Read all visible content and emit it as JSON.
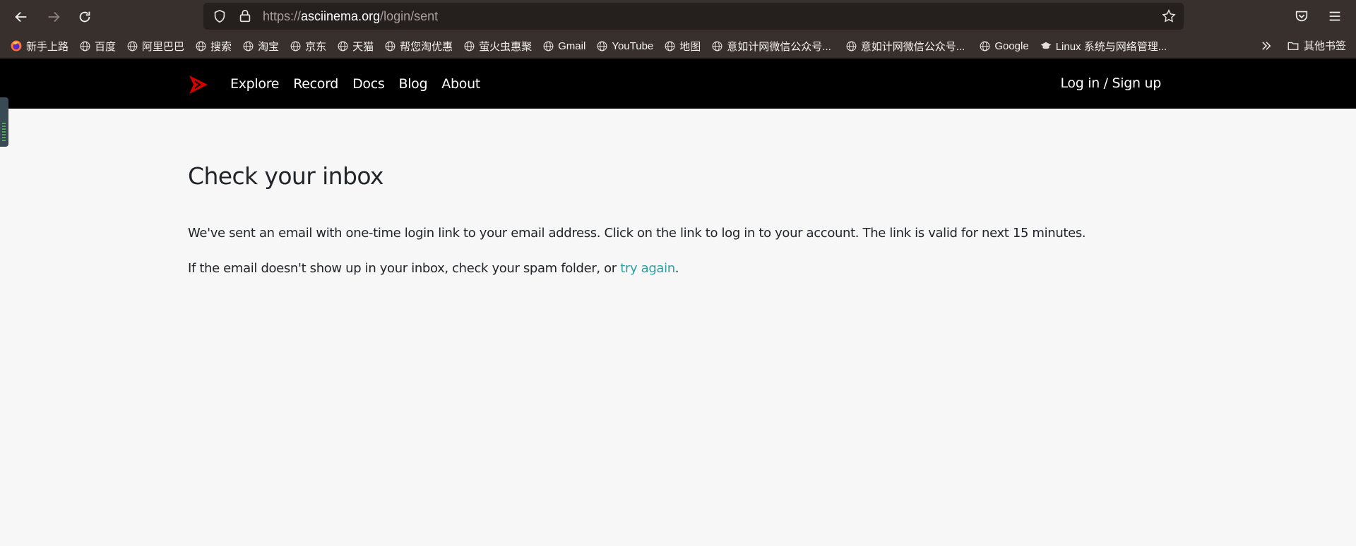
{
  "browser": {
    "url": {
      "scheme": "https://",
      "host": "asciinema.org",
      "path": "/login/sent"
    },
    "bookmarks": [
      {
        "label": "新手上路",
        "icon": "firefox-icon"
      },
      {
        "label": "百度",
        "icon": "globe-icon"
      },
      {
        "label": "阿里巴巴",
        "icon": "globe-icon"
      },
      {
        "label": "搜索",
        "icon": "globe-icon"
      },
      {
        "label": "淘宝",
        "icon": "globe-icon"
      },
      {
        "label": "京东",
        "icon": "globe-icon"
      },
      {
        "label": "天猫",
        "icon": "globe-icon"
      },
      {
        "label": "帮您淘优惠",
        "icon": "globe-icon"
      },
      {
        "label": "萤火虫惠聚",
        "icon": "globe-icon"
      },
      {
        "label": "Gmail",
        "icon": "globe-icon"
      },
      {
        "label": "YouTube",
        "icon": "globe-icon"
      },
      {
        "label": "地图",
        "icon": "globe-icon"
      },
      {
        "label": "意如计网微信公众号...",
        "icon": "globe-icon"
      },
      {
        "label": "意如计网微信公众号...",
        "icon": "globe-icon"
      },
      {
        "label": "Google",
        "icon": "globe-icon"
      },
      {
        "label": "Linux 系统与网络管理...",
        "icon": "graduation-cap-icon"
      }
    ],
    "other_bookmarks": "其他书签"
  },
  "site": {
    "nav": {
      "explore": "Explore",
      "record": "Record",
      "docs": "Docs",
      "blog": "Blog",
      "about": "About"
    },
    "login": "Log in / Sign up",
    "brand_color": "#d40000"
  },
  "content": {
    "title": "Check your inbox",
    "paragraph1": "We've sent an email with one-time login link to your email address. Click on the link to log in to your account. The link is valid for next 15 minutes.",
    "paragraph2_prefix": "If the email doesn't show up in your inbox, check your spam folder, or ",
    "paragraph2_link": "try again",
    "paragraph2_suffix": ".",
    "link_color": "#2e9fa1"
  }
}
